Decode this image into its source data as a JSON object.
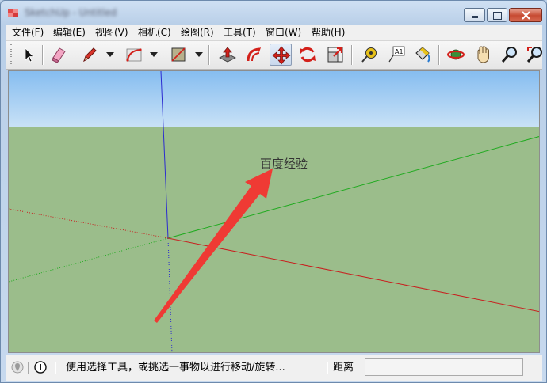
{
  "window": {
    "title": "SketchUp - Untitled"
  },
  "menu": [
    {
      "label": "文件(F)"
    },
    {
      "label": "编辑(E)"
    },
    {
      "label": "视图(V)"
    },
    {
      "label": "相机(C)"
    },
    {
      "label": "绘图(R)"
    },
    {
      "label": "工具(T)"
    },
    {
      "label": "窗口(W)"
    },
    {
      "label": "帮助(H)"
    }
  ],
  "toolbar": {
    "text_tool_glyph": "A1",
    "tools": [
      {
        "icon": "select-icon"
      },
      {
        "icon": "eraser-icon"
      },
      {
        "icon": "pencil-icon"
      },
      {
        "icon": "arc-icon"
      },
      {
        "icon": "rectangle-icon"
      },
      {
        "icon": "push-pull-icon"
      },
      {
        "icon": "offset-icon"
      },
      {
        "icon": "move-icon",
        "active": true
      },
      {
        "icon": "rotate-icon"
      },
      {
        "icon": "scale-icon"
      },
      {
        "icon": "tape-measure-icon"
      },
      {
        "icon": "text-icon"
      },
      {
        "icon": "paint-bucket-icon"
      },
      {
        "icon": "orbit-icon"
      },
      {
        "icon": "pan-icon"
      },
      {
        "icon": "zoom-icon"
      },
      {
        "icon": "zoom-extents-icon"
      }
    ]
  },
  "viewport": {
    "annotation": "百度经验",
    "sky_color": "#9ecaf2",
    "ground_color": "#9bbd8b",
    "axis_colors": {
      "blue": "#2b2bd0",
      "green": "#1faa1f",
      "red": "#c81f1f"
    },
    "arrow_color": "#ef3a34"
  },
  "status": {
    "message": "使用选择工具，或挑选一事物以进行移动/旋转...",
    "vcb_label": "距离",
    "vcb_value": ""
  }
}
